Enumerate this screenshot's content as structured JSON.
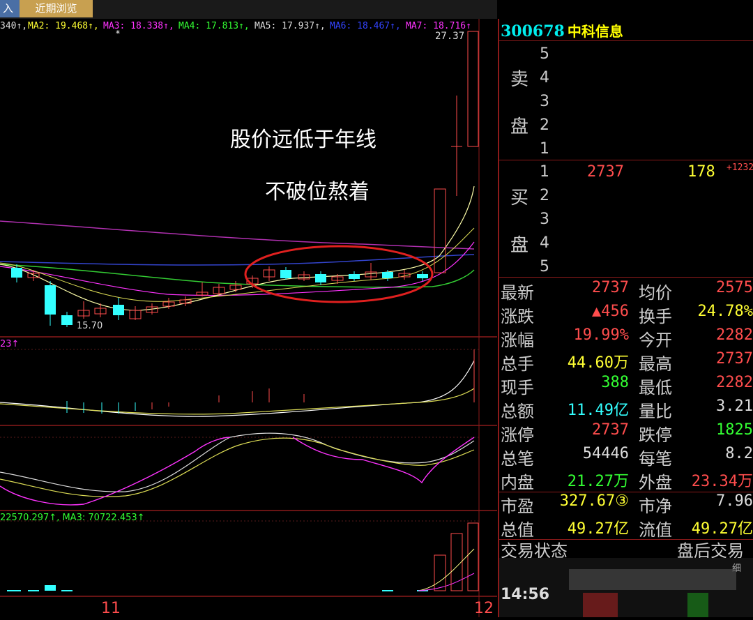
{
  "tabs": [
    "入",
    "近期浏览"
  ],
  "ma_line": {
    "ma1": "340↑,",
    "ma2": "MA2: 19.468↑,",
    "ma3": "MA3: 18.338↑,",
    "ma4": "MA4: 17.813↑,",
    "ma5": "MA5: 17.937↑,",
    "ma6": "MA6: 18.467↑,",
    "ma7": "MA7: 18.716↑"
  },
  "labels": {
    "high": "27.37",
    "low": "15.70",
    "annot1": "股价远低于年线",
    "annot2": "不破位熬着",
    "sub1": "23↑",
    "sub3": "22570.297↑, MA3: 70722.453↑",
    "star": "*",
    "x11": "11",
    "x12": "12"
  },
  "stock": {
    "code": "300678",
    "name": "中科信息"
  },
  "book": {
    "sell_label1": "卖",
    "sell_label2": "盘",
    "buy_label1": "买",
    "buy_label2": "盘",
    "sell_levels": [
      "5",
      "4",
      "3",
      "2",
      "1"
    ],
    "buy_levels": [
      "1",
      "2",
      "3",
      "4",
      "5"
    ],
    "buy1_price": "2737",
    "buy1_vol": "178",
    "buy1_chg": "+1232"
  },
  "quote": [
    {
      "l": "最新",
      "v": "2737",
      "c": "red",
      "l2": "均价",
      "v2": "2575",
      "c2": "red"
    },
    {
      "l": "涨跌",
      "v": "▲456",
      "c": "red",
      "l2": "换手",
      "v2": "24.78%",
      "c2": "yel"
    },
    {
      "l": "涨幅",
      "v": "19.99%",
      "c": "red",
      "l2": "今开",
      "v2": "2282",
      "c2": "red"
    },
    {
      "l": "总手",
      "v": "44.60万",
      "c": "yel",
      "l2": "最高",
      "v2": "2737",
      "c2": "red"
    },
    {
      "l": "现手",
      "v": "388",
      "c": "grn",
      "l2": "最低",
      "v2": "2282",
      "c2": "red"
    },
    {
      "l": "总额",
      "v": "11.49亿",
      "c": "cyn",
      "l2": "量比",
      "v2": "3.21",
      "c2": "wht"
    },
    {
      "l": "涨停",
      "v": "2737",
      "c": "red",
      "l2": "跌停",
      "v2": "1825",
      "c2": "grn"
    },
    {
      "l": "总笔",
      "v": "54446",
      "c": "wht",
      "l2": "每笔",
      "v2": "8.2",
      "c2": "wht"
    },
    {
      "l": "内盘",
      "v": "21.27万",
      "c": "grn",
      "l2": "外盘",
      "v2": "23.34万",
      "c2": "red"
    },
    {
      "l": "市盈",
      "v": "327.67③",
      "c": "yel",
      "l2": "市净",
      "v2": "7.96",
      "c2": "wht"
    },
    {
      "l": "总值",
      "v": "49.27亿",
      "c": "yel",
      "l2": "流值",
      "v2": "49.27亿",
      "c2": "yel"
    }
  ],
  "trade_state": {
    "label": "交易状态",
    "value": "盘后交易"
  },
  "tick": {
    "time": "14:56",
    "side": "细"
  }
}
